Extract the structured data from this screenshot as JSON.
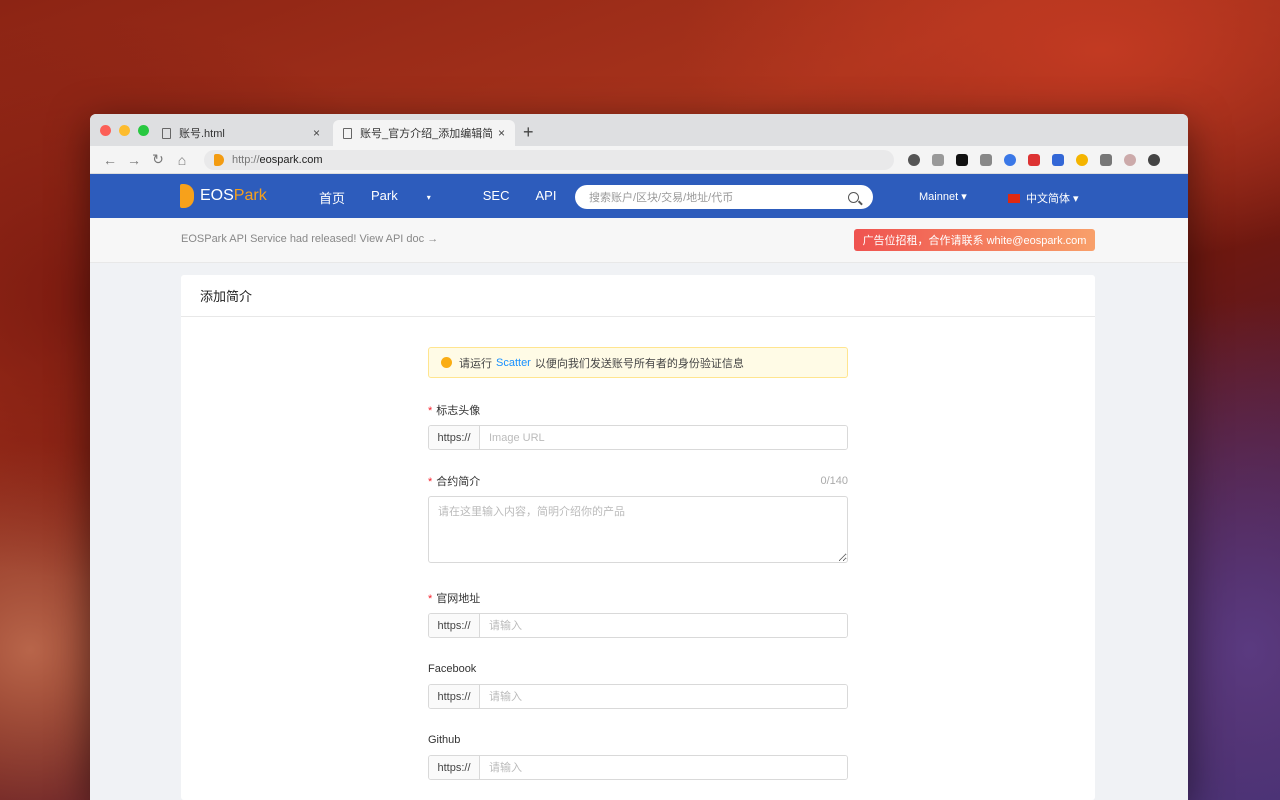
{
  "browser": {
    "tabs": [
      {
        "label": "账号.html"
      },
      {
        "label": "账号_官方介绍_添加编辑简介.html"
      }
    ],
    "url": {
      "scheme": "http://",
      "host": "eospark.com"
    },
    "new_tab": "+",
    "close": "×",
    "extensions": [
      "bulb-icon",
      "dropbox-icon",
      "vd-icon",
      "r-icon",
      "g-icon",
      "red-icon",
      "user-icon",
      "chrome-icon",
      "puzzle-icon",
      "avatar-icon",
      "update-icon"
    ]
  },
  "site": {
    "logo": {
      "eos": "EOS",
      "park": "Park"
    },
    "nav": [
      {
        "label": "首页"
      },
      {
        "label": "Park",
        "caret": "▾"
      },
      {
        "label": "SEC"
      },
      {
        "label": "API"
      }
    ],
    "search_placeholder": "搜索账户/区块/交易/地址/代币",
    "network": "Mainnet ▾",
    "language": "中文简体 ▾",
    "notice": "EOSPark API Service had released! View API doc →",
    "ad": "广告位招租，合作请联系 white@eospark.com"
  },
  "card": {
    "title": "添加简介",
    "alert": {
      "before": "请运行",
      "link": "Scatter",
      "after": "以便向我们发送账号所有者的身份验证信息"
    },
    "fields": {
      "avatar": {
        "label": "标志头像",
        "required": "*",
        "addon": "https://",
        "placeholder": "Image URL"
      },
      "intro": {
        "label": "合约简介",
        "required": "*",
        "counter": "0/140",
        "placeholder": "请在这里输入内容，简明介绍你的产品"
      },
      "website": {
        "label": "官网地址",
        "required": "*",
        "addon": "https://",
        "placeholder": "请输入"
      },
      "facebook": {
        "label": "Facebook",
        "addon": "https://",
        "placeholder": "请输入"
      },
      "github": {
        "label": "Github",
        "addon": "https://",
        "placeholder": "请输入"
      }
    }
  },
  "colors": {
    "brand_blue": "#2d5cbc",
    "accent_orange": "#f7a11b",
    "link": "#1890ff",
    "required": "#f5222d"
  }
}
